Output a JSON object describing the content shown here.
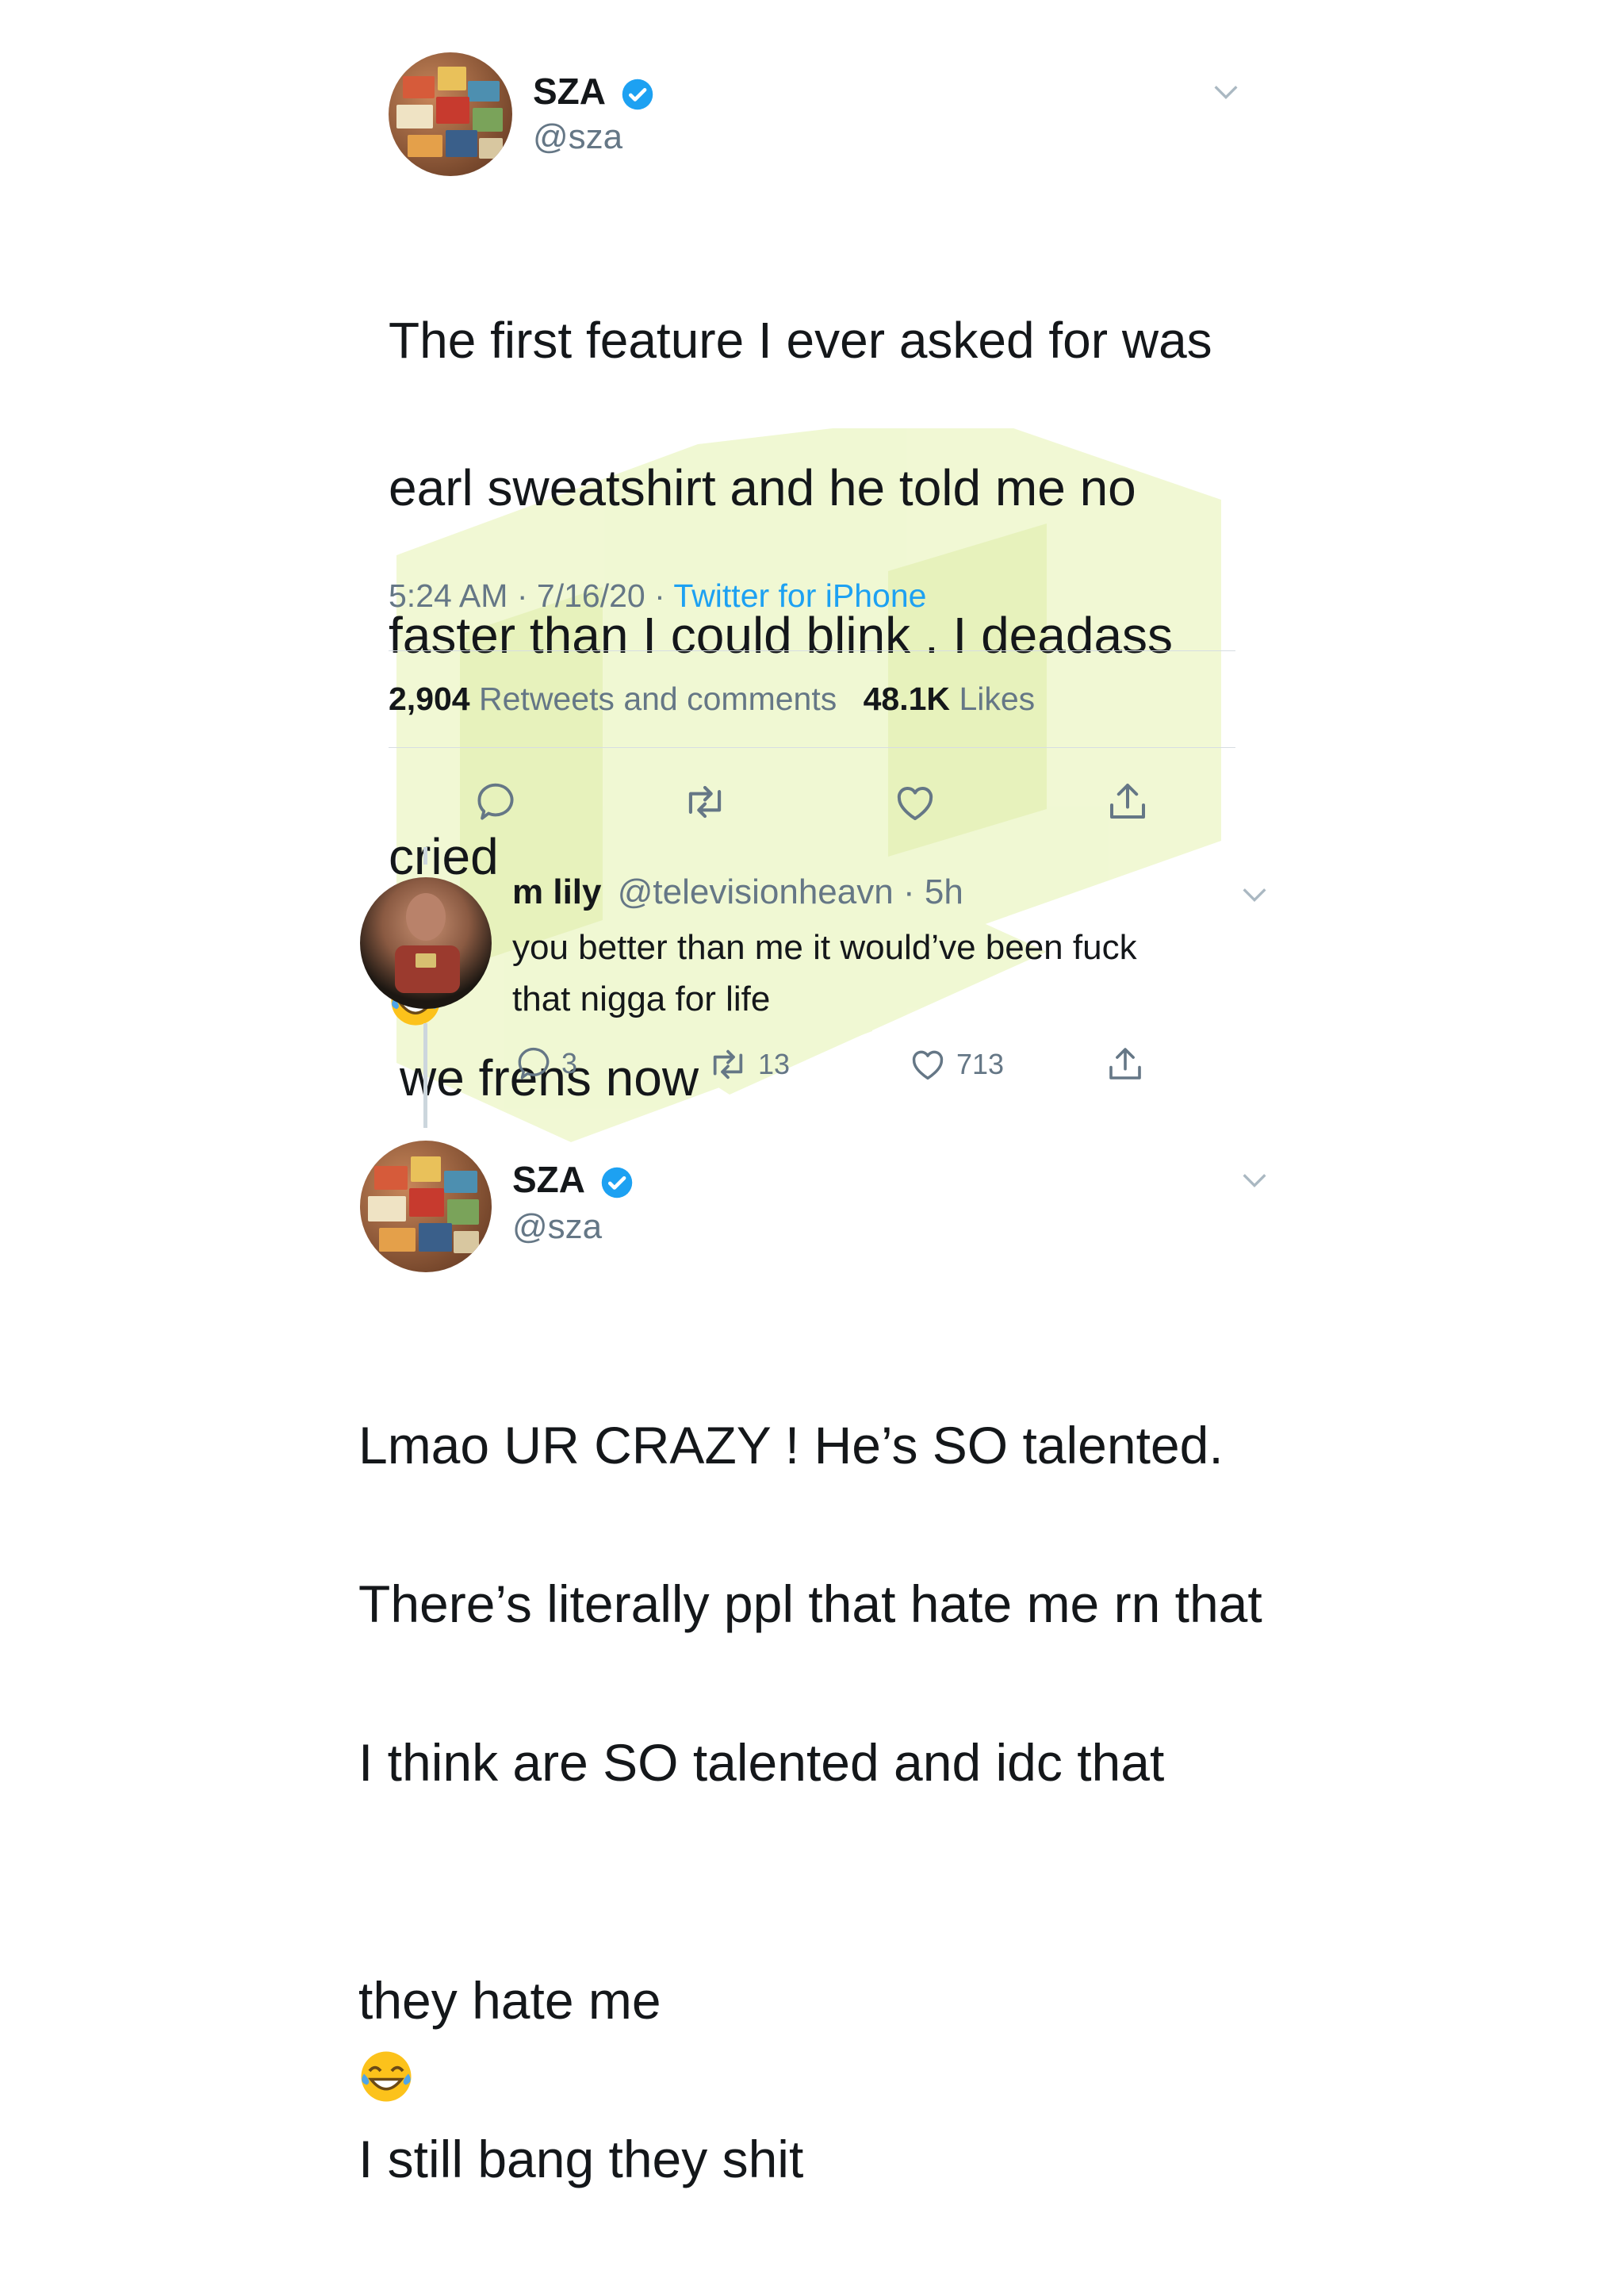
{
  "tweet": {
    "author": {
      "name": "SZA",
      "handle": "@sza",
      "verified": true
    },
    "text_lines": [
      "The first feature I ever asked for was",
      "earl sweatshirt and he told me no",
      "faster than I could blink . I deadass",
      "we frens now"
    ],
    "text_line4_prefix": "cried",
    "emoji": "face-with-tears-of-joy",
    "time": "5:24 AM",
    "date": "7/16/20",
    "source": "Twitter for iPhone",
    "retweets_count": "2,904",
    "retweets_label": "Retweets and comments",
    "likes_count": "48.1K",
    "likes_label": "Likes"
  },
  "reply": {
    "author": {
      "name": "m lily",
      "handle": "@televisionheavn"
    },
    "age": "5h",
    "text": "you better than me it would’ve been fuck\nthat nigga for life",
    "reply_count": "3",
    "retweet_count": "13",
    "like_count": "713"
  },
  "response": {
    "author": {
      "name": "SZA",
      "handle": "@sza",
      "verified": true
    },
    "text_lines": [
      "Lmao UR CRAZY ! He’s SO talented.",
      "There’s literally ppl that hate me rn that",
      "I think are SO talented and idc that"
    ],
    "last_line_prefix": "they hate me",
    "last_line_suffix": "I still bang they shit"
  },
  "colors": {
    "text": "#14171a",
    "secondary": "#657786",
    "link": "#1da1f2",
    "verified": "#1da1f2",
    "watermark": "#eef6c8"
  }
}
